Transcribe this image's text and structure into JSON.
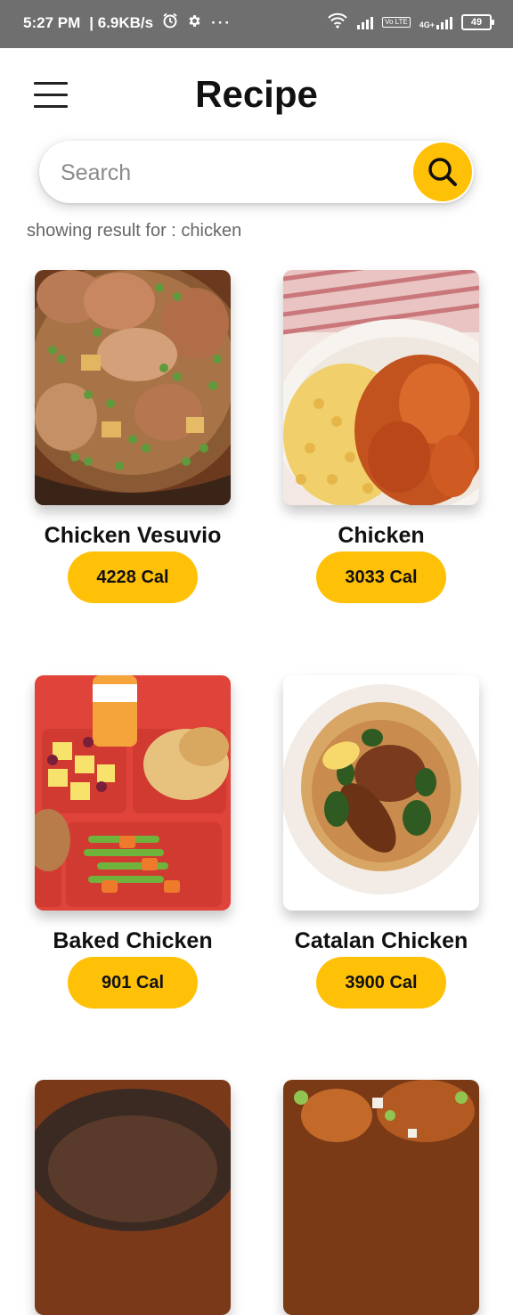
{
  "status_bar": {
    "time": "5:27 PM",
    "speed": "6.9KB/s",
    "battery": "49",
    "network": "4G+",
    "volte": "Vo LTE"
  },
  "header": {
    "title": "Recipe"
  },
  "search": {
    "placeholder": "Search",
    "value": ""
  },
  "result_text": "showing result for : chicken",
  "recipes": [
    {
      "name": "Chicken Vesuvio",
      "calories": "4228 Cal"
    },
    {
      "name": "Chicken",
      "calories": "3033 Cal"
    },
    {
      "name": "Baked Chicken",
      "calories": "901 Cal"
    },
    {
      "name": "Catalan Chicken",
      "calories": "3900 Cal"
    },
    {
      "name": "",
      "calories": ""
    },
    {
      "name": "",
      "calories": ""
    }
  ],
  "colors": {
    "accent": "#FFC107",
    "status_bar": "#6f6f6f"
  }
}
